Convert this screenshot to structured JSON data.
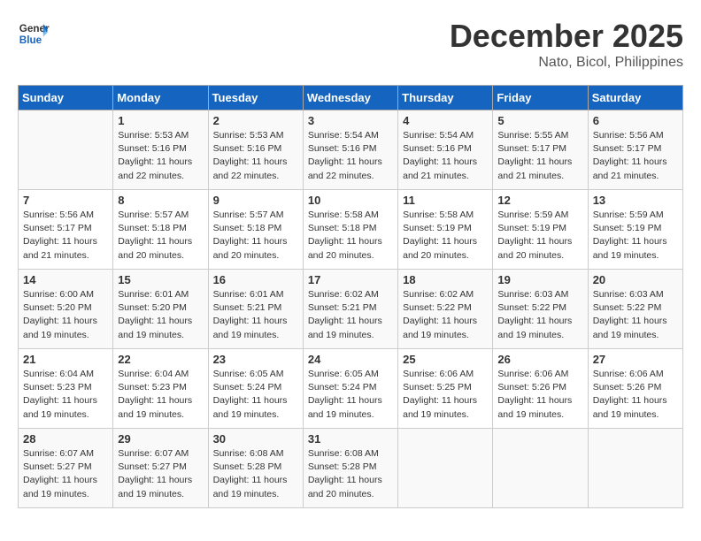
{
  "header": {
    "logo_line1": "General",
    "logo_line2": "Blue",
    "month_year": "December 2025",
    "location": "Nato, Bicol, Philippines"
  },
  "days_of_week": [
    "Sunday",
    "Monday",
    "Tuesday",
    "Wednesday",
    "Thursday",
    "Friday",
    "Saturday"
  ],
  "weeks": [
    [
      {
        "num": "",
        "info": ""
      },
      {
        "num": "1",
        "info": "Sunrise: 5:53 AM\nSunset: 5:16 PM\nDaylight: 11 hours\nand 22 minutes."
      },
      {
        "num": "2",
        "info": "Sunrise: 5:53 AM\nSunset: 5:16 PM\nDaylight: 11 hours\nand 22 minutes."
      },
      {
        "num": "3",
        "info": "Sunrise: 5:54 AM\nSunset: 5:16 PM\nDaylight: 11 hours\nand 22 minutes."
      },
      {
        "num": "4",
        "info": "Sunrise: 5:54 AM\nSunset: 5:16 PM\nDaylight: 11 hours\nand 21 minutes."
      },
      {
        "num": "5",
        "info": "Sunrise: 5:55 AM\nSunset: 5:17 PM\nDaylight: 11 hours\nand 21 minutes."
      },
      {
        "num": "6",
        "info": "Sunrise: 5:56 AM\nSunset: 5:17 PM\nDaylight: 11 hours\nand 21 minutes."
      }
    ],
    [
      {
        "num": "7",
        "info": "Sunrise: 5:56 AM\nSunset: 5:17 PM\nDaylight: 11 hours\nand 21 minutes."
      },
      {
        "num": "8",
        "info": "Sunrise: 5:57 AM\nSunset: 5:18 PM\nDaylight: 11 hours\nand 20 minutes."
      },
      {
        "num": "9",
        "info": "Sunrise: 5:57 AM\nSunset: 5:18 PM\nDaylight: 11 hours\nand 20 minutes."
      },
      {
        "num": "10",
        "info": "Sunrise: 5:58 AM\nSunset: 5:18 PM\nDaylight: 11 hours\nand 20 minutes."
      },
      {
        "num": "11",
        "info": "Sunrise: 5:58 AM\nSunset: 5:19 PM\nDaylight: 11 hours\nand 20 minutes."
      },
      {
        "num": "12",
        "info": "Sunrise: 5:59 AM\nSunset: 5:19 PM\nDaylight: 11 hours\nand 20 minutes."
      },
      {
        "num": "13",
        "info": "Sunrise: 5:59 AM\nSunset: 5:19 PM\nDaylight: 11 hours\nand 19 minutes."
      }
    ],
    [
      {
        "num": "14",
        "info": "Sunrise: 6:00 AM\nSunset: 5:20 PM\nDaylight: 11 hours\nand 19 minutes."
      },
      {
        "num": "15",
        "info": "Sunrise: 6:01 AM\nSunset: 5:20 PM\nDaylight: 11 hours\nand 19 minutes."
      },
      {
        "num": "16",
        "info": "Sunrise: 6:01 AM\nSunset: 5:21 PM\nDaylight: 11 hours\nand 19 minutes."
      },
      {
        "num": "17",
        "info": "Sunrise: 6:02 AM\nSunset: 5:21 PM\nDaylight: 11 hours\nand 19 minutes."
      },
      {
        "num": "18",
        "info": "Sunrise: 6:02 AM\nSunset: 5:22 PM\nDaylight: 11 hours\nand 19 minutes."
      },
      {
        "num": "19",
        "info": "Sunrise: 6:03 AM\nSunset: 5:22 PM\nDaylight: 11 hours\nand 19 minutes."
      },
      {
        "num": "20",
        "info": "Sunrise: 6:03 AM\nSunset: 5:22 PM\nDaylight: 11 hours\nand 19 minutes."
      }
    ],
    [
      {
        "num": "21",
        "info": "Sunrise: 6:04 AM\nSunset: 5:23 PM\nDaylight: 11 hours\nand 19 minutes."
      },
      {
        "num": "22",
        "info": "Sunrise: 6:04 AM\nSunset: 5:23 PM\nDaylight: 11 hours\nand 19 minutes."
      },
      {
        "num": "23",
        "info": "Sunrise: 6:05 AM\nSunset: 5:24 PM\nDaylight: 11 hours\nand 19 minutes."
      },
      {
        "num": "24",
        "info": "Sunrise: 6:05 AM\nSunset: 5:24 PM\nDaylight: 11 hours\nand 19 minutes."
      },
      {
        "num": "25",
        "info": "Sunrise: 6:06 AM\nSunset: 5:25 PM\nDaylight: 11 hours\nand 19 minutes."
      },
      {
        "num": "26",
        "info": "Sunrise: 6:06 AM\nSunset: 5:26 PM\nDaylight: 11 hours\nand 19 minutes."
      },
      {
        "num": "27",
        "info": "Sunrise: 6:06 AM\nSunset: 5:26 PM\nDaylight: 11 hours\nand 19 minutes."
      }
    ],
    [
      {
        "num": "28",
        "info": "Sunrise: 6:07 AM\nSunset: 5:27 PM\nDaylight: 11 hours\nand 19 minutes."
      },
      {
        "num": "29",
        "info": "Sunrise: 6:07 AM\nSunset: 5:27 PM\nDaylight: 11 hours\nand 19 minutes."
      },
      {
        "num": "30",
        "info": "Sunrise: 6:08 AM\nSunset: 5:28 PM\nDaylight: 11 hours\nand 19 minutes."
      },
      {
        "num": "31",
        "info": "Sunrise: 6:08 AM\nSunset: 5:28 PM\nDaylight: 11 hours\nand 20 minutes."
      },
      {
        "num": "",
        "info": ""
      },
      {
        "num": "",
        "info": ""
      },
      {
        "num": "",
        "info": ""
      }
    ]
  ]
}
